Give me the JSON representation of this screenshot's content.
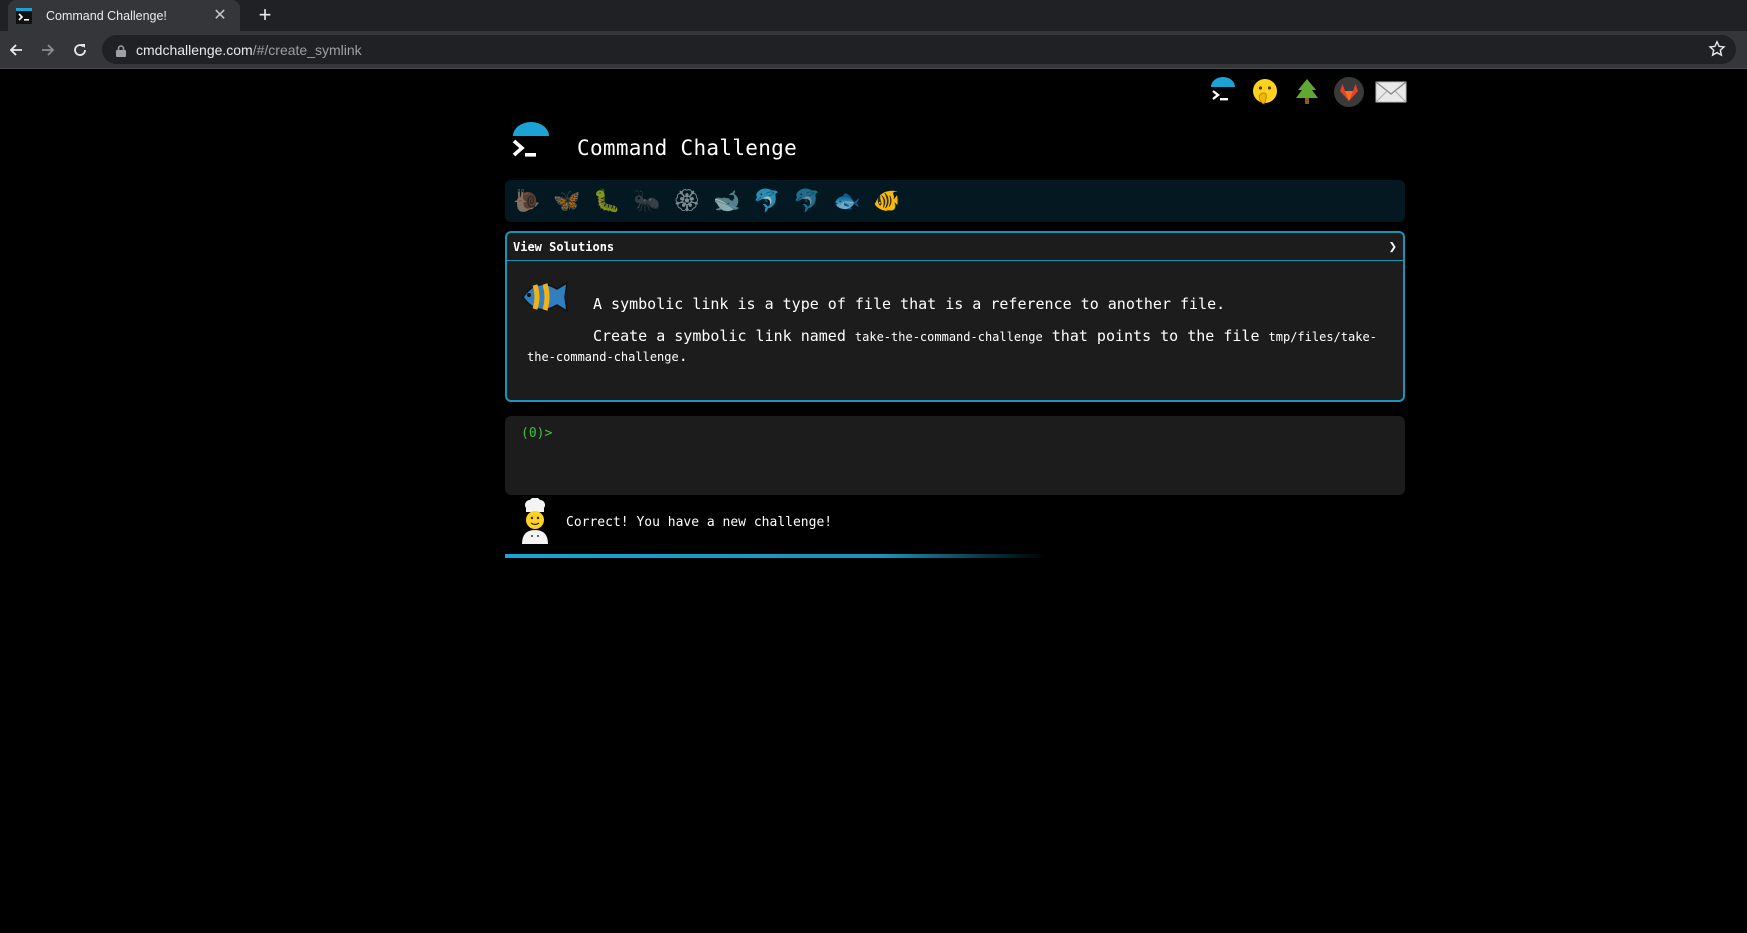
{
  "browser": {
    "tab_title": "Command Challenge!",
    "new_tab_label": "+",
    "url_host": "cmdchallenge.com",
    "url_path": "/#/create_symlink"
  },
  "page": {
    "title": "Command Challenge",
    "top_icons": [
      "terminal-logo",
      "face-hand-over-mouth",
      "evergreen-tree",
      "gitlab-logo",
      "envelope"
    ],
    "levels": [
      "🐌",
      "🦋",
      "🐛",
      "🐜",
      "🏵",
      "🐋",
      "🐬",
      "🐬",
      "🐟",
      "🐠"
    ],
    "solutions_label": "View Solutions",
    "solutions_chevron": "❯",
    "challenge_intro": "A symbolic link is a type of file that is a reference to another file.",
    "challenge_text_pre": "Create a symbolic link named ",
    "challenge_name": "take-the-command-challenge",
    "challenge_text_mid": " that points to the file ",
    "challenge_target": "tmp/files/take-the-command-challenge",
    "challenge_text_end": ".",
    "prompt": "(0)>",
    "status_message": "Correct! You have a new challenge!"
  },
  "colors": {
    "accent": "#1a93b8",
    "prompt_green": "#3ac63a",
    "background": "#000000",
    "panel": "#1c1c1c"
  }
}
